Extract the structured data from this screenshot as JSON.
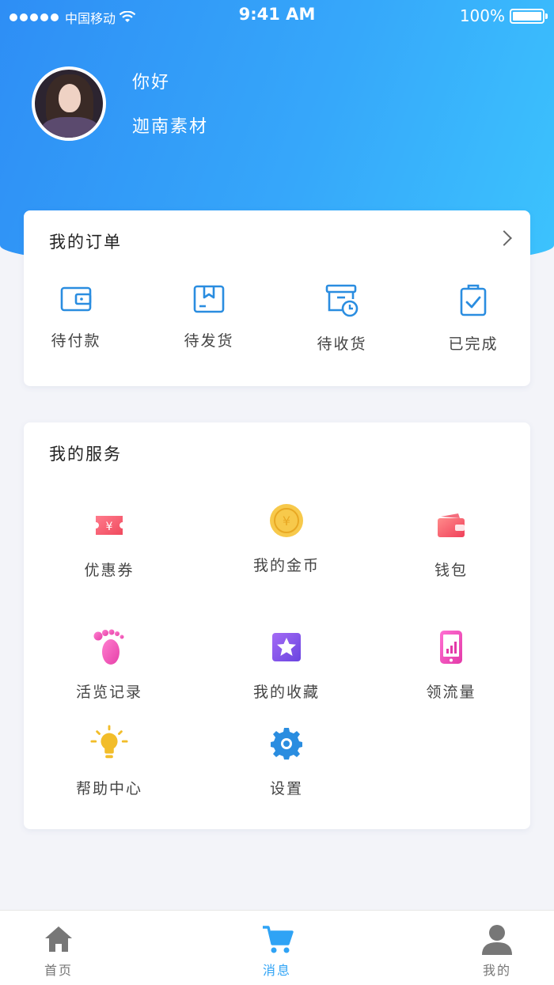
{
  "status_bar": {
    "carrier": "中国移动",
    "time": "9:41 AM",
    "battery": "100%"
  },
  "profile": {
    "greeting": "你好",
    "username": "迦南素材"
  },
  "orders": {
    "title": "我的订单",
    "items": [
      {
        "label": "待付款",
        "icon": "wallet-icon"
      },
      {
        "label": "待发货",
        "icon": "box-icon"
      },
      {
        "label": "待收货",
        "icon": "delivery-icon"
      },
      {
        "label": "已完成",
        "icon": "clipboard-check-icon"
      }
    ]
  },
  "services": {
    "title": "我的服务",
    "items": [
      {
        "label": "优惠券",
        "icon": "coupon-icon"
      },
      {
        "label": "我的金币",
        "icon": "coin-icon"
      },
      {
        "label": "钱包",
        "icon": "wallet-icon"
      },
      {
        "label": "活览记录",
        "icon": "footprint-icon"
      },
      {
        "label": "我的收藏",
        "icon": "star-icon"
      },
      {
        "label": "领流量",
        "icon": "phone-data-icon"
      },
      {
        "label": "帮助中心",
        "icon": "lightbulb-icon"
      },
      {
        "label": "设置",
        "icon": "gear-icon"
      }
    ]
  },
  "tabbar": {
    "items": [
      {
        "label": "首页",
        "icon": "home-icon"
      },
      {
        "label": "消息",
        "icon": "cart-icon",
        "active": true
      },
      {
        "label": "我的",
        "icon": "user-icon"
      }
    ]
  },
  "colors": {
    "accent": "#2fa3f5",
    "header_start": "#2e8ef5",
    "header_end": "#3cc3fd",
    "order_icon": "#2a8de0"
  }
}
